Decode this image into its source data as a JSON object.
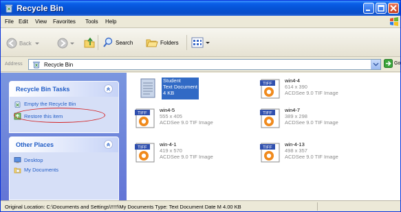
{
  "window": {
    "title": "Recycle Bin"
  },
  "menu": [
    "File",
    "Edit",
    "View",
    "Favorites",
    "Tools",
    "Help"
  ],
  "toolbar": {
    "back_label": "Back",
    "search_label": "Search",
    "folders_label": "Folders"
  },
  "address": {
    "label": "Address",
    "value": "Recycle Bin",
    "go_label": "Go"
  },
  "tasks": {
    "title": "Recycle Bin Tasks",
    "items": [
      {
        "label": "Empty the Recycle Bin"
      },
      {
        "label": "Restore this item"
      }
    ]
  },
  "places": {
    "title": "Other Places",
    "items": [
      {
        "label": "Desktop"
      },
      {
        "label": "My Documents"
      }
    ]
  },
  "files": [
    {
      "name": "Student",
      "line2": "Text Document",
      "line3": "4 KB",
      "type": "text",
      "selected": true
    },
    {
      "name": "win4-4",
      "line2": "614 x 390",
      "line3": "ACDSee 9.0 TIF Image",
      "type": "tiff",
      "selected": false
    },
    {
      "name": "win4-5",
      "line2": "555 x 405",
      "line3": "ACDSee 9.0 TIF Image",
      "type": "tiff",
      "selected": false
    },
    {
      "name": "win4-7",
      "line2": "389 x 298",
      "line3": "ACDSee 9.0 TIF Image",
      "type": "tiff",
      "selected": false
    },
    {
      "name": "win-4-1",
      "line2": "419 x 570",
      "line3": "ACDSee 9.0 TIF Image",
      "type": "tiff",
      "selected": false
    },
    {
      "name": "win-4-13",
      "line2": "498 x 357",
      "line3": "ACDSee 9.0 TIF Image",
      "type": "tiff",
      "selected": false
    }
  ],
  "tiff_badge": "TIFF",
  "status": {
    "text": "Original Location: C:\\Documents and Settings\\!!!!!\\My Documents Type: Text Document Date M 4.00 KB"
  },
  "colors": {
    "titlebar": "#0553d6",
    "left_pane": "#6f86db",
    "task_link": "#215dc6",
    "selection": "#316ac5",
    "highlight_ellipse": "#d42020",
    "tiff_badge": "#2f4fae",
    "acdsee_orange": "#f08a1c"
  }
}
